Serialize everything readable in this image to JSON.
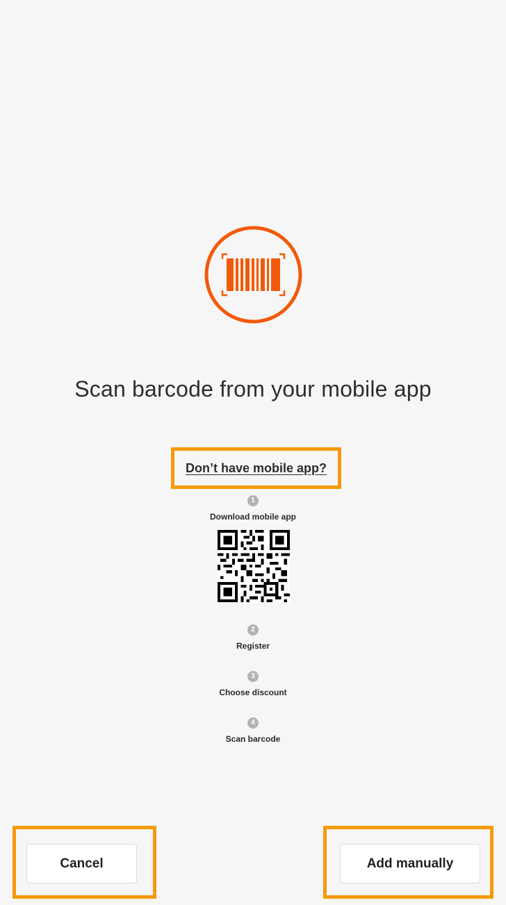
{
  "main": {
    "title": "Scan barcode from your mobile app",
    "help_link": "Don’t have mobile app?",
    "steps": [
      {
        "number": "1",
        "label": "Download mobile app"
      },
      {
        "number": "2",
        "label": "Register"
      },
      {
        "number": "3",
        "label": "Choose discount"
      },
      {
        "number": "4",
        "label": "Scan barcode"
      }
    ]
  },
  "icons": {
    "emblem": "barcode-scan-icon",
    "qr": "qr-code"
  },
  "footer": {
    "cancel_label": "Cancel",
    "add_label": "Add manually"
  },
  "colors": {
    "accent": "#f15a0a",
    "highlight": "#f59a0a",
    "background": "#f6f6f6"
  }
}
